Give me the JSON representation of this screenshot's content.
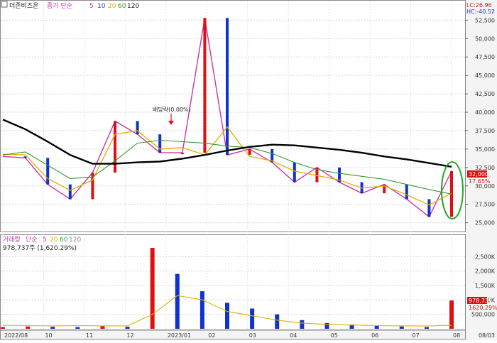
{
  "price_panel": {
    "legend": {
      "name": "더존비즈온",
      "study": "종가 단순",
      "periods": [
        "5",
        "10",
        "20",
        "60",
        "120"
      ]
    },
    "lc_label": "LC:26.96",
    "hc_label": "HC:-40.52",
    "annotation": "배당락(0.00%)",
    "current_price": "32,000",
    "current_change": "17.65%"
  },
  "volume_panel": {
    "legend": {
      "name": "거래량",
      "study": "단순",
      "periods": [
        "5",
        "20",
        "60",
        "120"
      ]
    },
    "summary": "978,737주 (1,620.29%)",
    "current_volume": "978,737",
    "current_change": "1620.29%"
  },
  "x_axis": {
    "labels": [
      "2022/08",
      "10",
      "11",
      "12",
      "2023/01",
      "02",
      "03",
      "04",
      "05",
      "06",
      "07",
      "08",
      "08/03"
    ]
  },
  "colors": {
    "up": "#dd1111",
    "down": "#1133cc",
    "ma5": "#cc33aa",
    "ma10": "#3344cc",
    "ma20": "#e0b000",
    "ma60": "#339933",
    "ma120": "#000000",
    "highlight": "#22aa22"
  },
  "chart_data": [
    {
      "type": "line",
      "title": "",
      "ylim": [
        24000,
        53500
      ],
      "y_ticks": [
        "52,500",
        "50,000",
        "47,500",
        "45,000",
        "42,500",
        "40,000",
        "37,500",
        "35,000",
        "32,500",
        "30,000",
        "27,500",
        "25,000"
      ],
      "x": [
        "2022/08",
        "10",
        "11",
        "12",
        "2023/01",
        "02",
        "03",
        "04",
        "05",
        "06",
        "07",
        "08"
      ],
      "series": [
        {
          "name": "종가",
          "values": [
            34000,
            33800,
            30200,
            28200,
            31800,
            38800,
            37000,
            34500,
            34500,
            52800,
            34200,
            35000,
            33200,
            30500,
            32500,
            30500,
            29000,
            30200,
            28200,
            25800,
            32000
          ]
        },
        {
          "name": "20",
          "values": [
            34300,
            34200,
            31000,
            29400,
            30800,
            37000,
            37500,
            35000,
            35200,
            34200,
            38000,
            34000,
            33400,
            32000,
            31400,
            30800,
            29700,
            30000,
            28800,
            27400,
            29000
          ]
        },
        {
          "name": "60",
          "values": [
            34200,
            34600,
            32800,
            31000,
            31200,
            33400,
            35800,
            36200,
            36000,
            35800,
            35400,
            35200,
            34400,
            33200,
            32200,
            31700,
            31300,
            30900,
            30200,
            29500,
            28900
          ]
        },
        {
          "name": "120",
          "values": [
            39000,
            37700,
            36000,
            34200,
            33000,
            33000,
            33200,
            33300,
            33700,
            34200,
            34800,
            35300,
            35600,
            35500,
            35200,
            34900,
            34500,
            34000,
            33600,
            33100,
            32600
          ]
        }
      ]
    },
    {
      "type": "bar",
      "title": "",
      "ylim": [
        0,
        2900000
      ],
      "y_ticks": [
        "2,500K",
        "2,000K",
        "1,500K",
        "1,000K",
        "500,000"
      ],
      "x": [
        "2022/08",
        "10",
        "11",
        "12",
        "2023/01",
        "02",
        "03",
        "04",
        "05",
        "06",
        "07",
        "08"
      ],
      "series": [
        {
          "name": "거래량",
          "values": [
            60000,
            80000,
            70000,
            60000,
            90000,
            70000,
            2800000,
            1900000,
            1300000,
            900000,
            700000,
            500000,
            300000,
            200000,
            150000,
            100000,
            80000,
            60000,
            978737
          ]
        },
        {
          "name": "20",
          "values": [
            120000,
            110000,
            100000,
            110000,
            100000,
            100000,
            500000,
            1150000,
            1000000,
            600000,
            450000,
            300000,
            200000,
            150000,
            130000,
            110000,
            100000,
            95000,
            120000
          ]
        }
      ]
    }
  ]
}
